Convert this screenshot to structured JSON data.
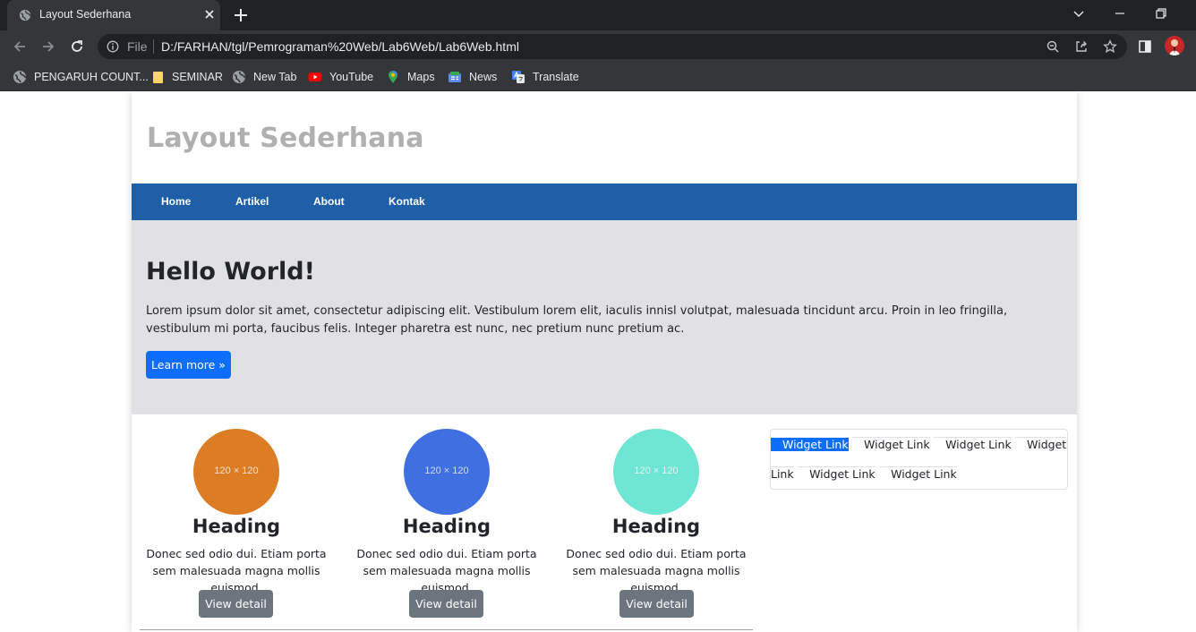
{
  "browser": {
    "tab_title": "Layout Sederhana",
    "omnibox": {
      "scheme_label": "File",
      "url": "D:/FARHAN/tgl/Pemrograman%20Web/Lab6Web/Lab6Web.html"
    },
    "bookmarks": [
      {
        "label": "PENGARUH COUNT...",
        "icon": "globe-icon"
      },
      {
        "label": "SEMINAR",
        "icon": "folder-icon"
      },
      {
        "label": "New Tab",
        "icon": "globe-icon"
      },
      {
        "label": "YouTube",
        "icon": "youtube-icon"
      },
      {
        "label": "Maps",
        "icon": "maps-icon"
      },
      {
        "label": "News",
        "icon": "news-icon"
      },
      {
        "label": "Translate",
        "icon": "translate-icon"
      }
    ]
  },
  "page": {
    "site_title": "Layout Sederhana",
    "nav": [
      "Home",
      "Artikel",
      "About",
      "Kontak"
    ],
    "hero": {
      "title": "Hello World!",
      "text": "Lorem ipsum dolor sit amet, consectetur adipiscing elit. Vestibulum lorem elit, iaculis innisl volutpat, malesuada tincidunt arcu. Proin in leo fringilla, vestibulum mi porta, faucibus felis. Integer pharetra est nunc, nec pretium nunc pretium ac.",
      "button": "Learn more »"
    },
    "cards": [
      {
        "image_label": "120 × 120",
        "color": "#dc7d26",
        "heading": "Heading",
        "text": "Donec sed odio dui. Etiam porta sem malesuada magna mollis euismod.",
        "button": "View detail"
      },
      {
        "image_label": "120 × 120",
        "color": "#3f6fe1",
        "heading": "Heading",
        "text": "Donec sed odio dui. Etiam porta sem malesuada magna mollis euismod.",
        "button": "View detail"
      },
      {
        "image_label": "120 × 120",
        "color": "#6fe5d3",
        "heading": "Heading",
        "text": "Donec sed odio dui. Etiam porta sem malesuada magna mollis euismod.",
        "button": "View detail"
      }
    ],
    "widget_links": [
      "Widget Link",
      "Widget Link",
      "Widget Link",
      "Widget Link",
      "Widget Link",
      "Widget Link"
    ],
    "active_widget_index": 0
  },
  "colors": {
    "navbar": "#1f5fa8",
    "hero_bg": "#e1e1e4",
    "primary": "#0d6efd",
    "secondary": "#6c757d"
  }
}
